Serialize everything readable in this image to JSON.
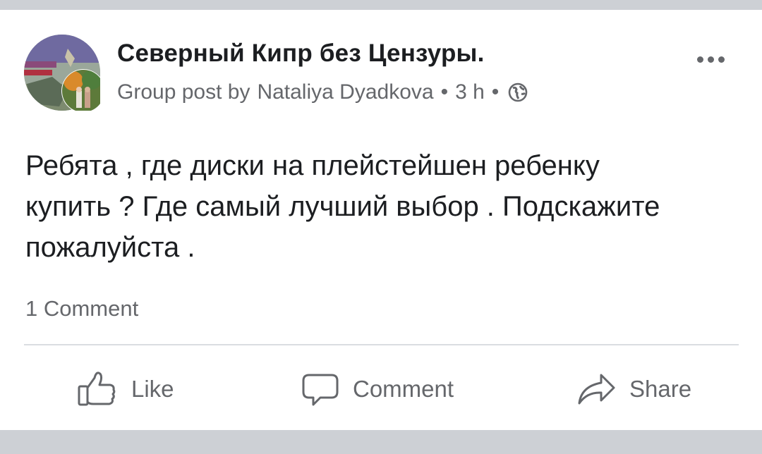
{
  "post": {
    "group_name": "Северный Кипр без Цензуры.",
    "meta": {
      "prefix": "Group post by",
      "author": "Nataliya  Dyadkova",
      "separator": "•",
      "time": "3 h",
      "privacy_icon": "globe-icon"
    },
    "avatar": {
      "banner_text_top": "Северный Кипр",
      "banner_text_bottom": "без цензуры"
    },
    "more_icon": "more-dots-icon",
    "text_lines": [
      "Ребята , где диски на плейстейшен ребенку",
      "купить ? Где самый лучший выбор . Подскажите",
      "пожалуйста ."
    ],
    "comments_count_label": "1 Comment"
  },
  "actions": {
    "like": {
      "label": "Like",
      "icon": "thumbs-up-icon"
    },
    "comment": {
      "label": "Comment",
      "icon": "speech-bubble-icon"
    },
    "share": {
      "label": "Share",
      "icon": "share-arrow-icon"
    }
  },
  "colors": {
    "page_background": "#cdd0d5",
    "card_background": "#ffffff",
    "primary_text": "#1c1e21",
    "secondary_text": "#65676b",
    "divider": "#dadde1"
  }
}
